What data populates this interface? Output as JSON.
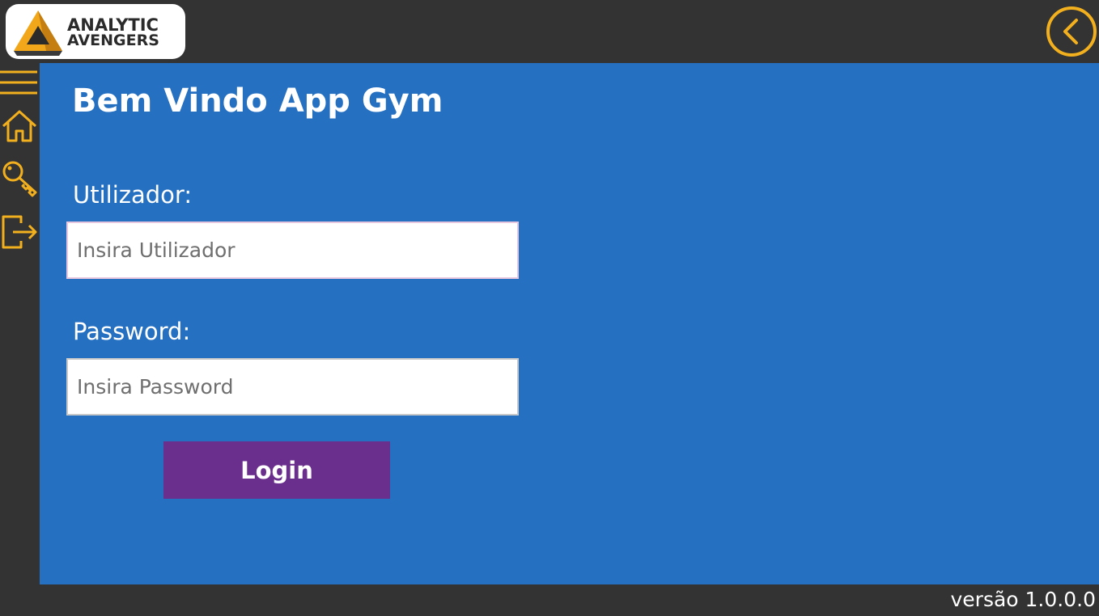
{
  "header": {
    "logo": {
      "line1": "ANALYTIC",
      "line2": "AVENGERS"
    },
    "back_icon": "chevron-left-circle-icon"
  },
  "sidebar": {
    "items": [
      {
        "icon": "menu-icon"
      },
      {
        "icon": "home-icon"
      },
      {
        "icon": "key-icon"
      },
      {
        "icon": "logout-icon"
      }
    ]
  },
  "main": {
    "title": "Bem Vindo App Gym",
    "username": {
      "label": "Utilizador:",
      "placeholder": "Insira Utilizador",
      "value": ""
    },
    "password": {
      "label": "Password:",
      "placeholder": "Insira Password",
      "value": ""
    },
    "login_label": "Login"
  },
  "footer": {
    "version": "versão 1.0.0.0"
  },
  "colors": {
    "accent": "#f2b01e",
    "main_bg": "#2670c2",
    "chrome_bg": "#333333",
    "button_bg": "#6a2e8c"
  }
}
